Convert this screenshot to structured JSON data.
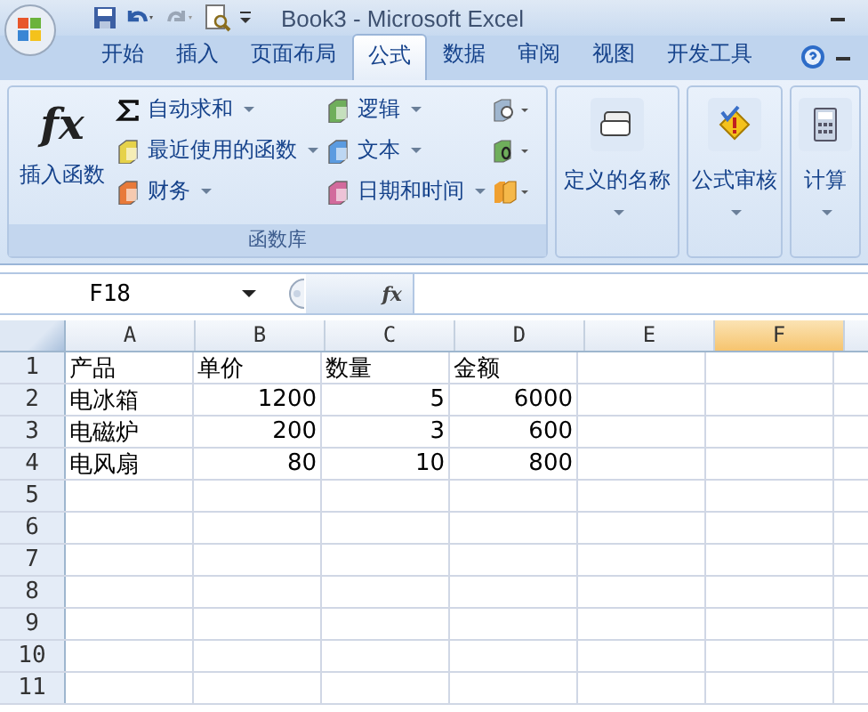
{
  "title_bar": {
    "title": "Book3 - Microsoft Excel"
  },
  "tabs": [
    {
      "label": "开始",
      "selected": false
    },
    {
      "label": "插入",
      "selected": false
    },
    {
      "label": "页面布局",
      "selected": false
    },
    {
      "label": "公式",
      "selected": true
    },
    {
      "label": "数据",
      "selected": false
    },
    {
      "label": "审阅",
      "selected": false
    },
    {
      "label": "视图",
      "selected": false
    },
    {
      "label": "开发工具",
      "selected": false
    }
  ],
  "ribbon": {
    "function_library": {
      "label": "函数库",
      "insert_function": {
        "symbol": "fx",
        "label": "插入函数"
      },
      "commands": [
        {
          "label": "自动求和",
          "kind": "sum"
        },
        {
          "label": "最近使用的函数",
          "kind": "book"
        },
        {
          "label": "财务",
          "kind": "book"
        },
        {
          "label": "逻辑",
          "kind": "book"
        },
        {
          "label": "文本",
          "kind": "book"
        },
        {
          "label": "日期和时间",
          "kind": "book"
        }
      ]
    },
    "groups": [
      {
        "label": "定义的名称",
        "kind": "names"
      },
      {
        "label": "公式审核",
        "kind": "audit"
      },
      {
        "label": "计算",
        "kind": "calc"
      }
    ]
  },
  "formula_bar": {
    "name_box": "F18",
    "fx": "fx"
  },
  "sheet": {
    "columns": [
      {
        "label": "A",
        "selected": false
      },
      {
        "label": "B",
        "selected": false
      },
      {
        "label": "C",
        "selected": false
      },
      {
        "label": "D",
        "selected": false
      },
      {
        "label": "E",
        "selected": false
      },
      {
        "label": "F",
        "selected": true
      }
    ],
    "rows": [
      {
        "header": "1",
        "cells": [
          {
            "text": "产品",
            "kind": "text"
          },
          {
            "text": "单价",
            "kind": "text"
          },
          {
            "text": "数量",
            "kind": "text"
          },
          {
            "text": "金额",
            "kind": "text"
          }
        ]
      },
      {
        "header": "2",
        "cells": [
          {
            "text": "电冰箱",
            "kind": "text"
          },
          {
            "text": "1200",
            "kind": "number"
          },
          {
            "text": "5",
            "kind": "number"
          },
          {
            "text": "6000",
            "kind": "number"
          }
        ]
      },
      {
        "header": "3",
        "cells": [
          {
            "text": "电磁炉",
            "kind": "text"
          },
          {
            "text": "200",
            "kind": "number"
          },
          {
            "text": "3",
            "kind": "number"
          },
          {
            "text": "600",
            "kind": "number"
          }
        ]
      },
      {
        "header": "4",
        "cells": [
          {
            "text": "电风扇",
            "kind": "text"
          },
          {
            "text": "80",
            "kind": "number"
          },
          {
            "text": "10",
            "kind": "number"
          },
          {
            "text": "800",
            "kind": "number"
          }
        ]
      },
      {
        "header": "5"
      },
      {
        "header": "6"
      },
      {
        "header": "7"
      },
      {
        "header": "8"
      },
      {
        "header": "9"
      },
      {
        "header": "10"
      },
      {
        "header": "11"
      }
    ]
  }
}
